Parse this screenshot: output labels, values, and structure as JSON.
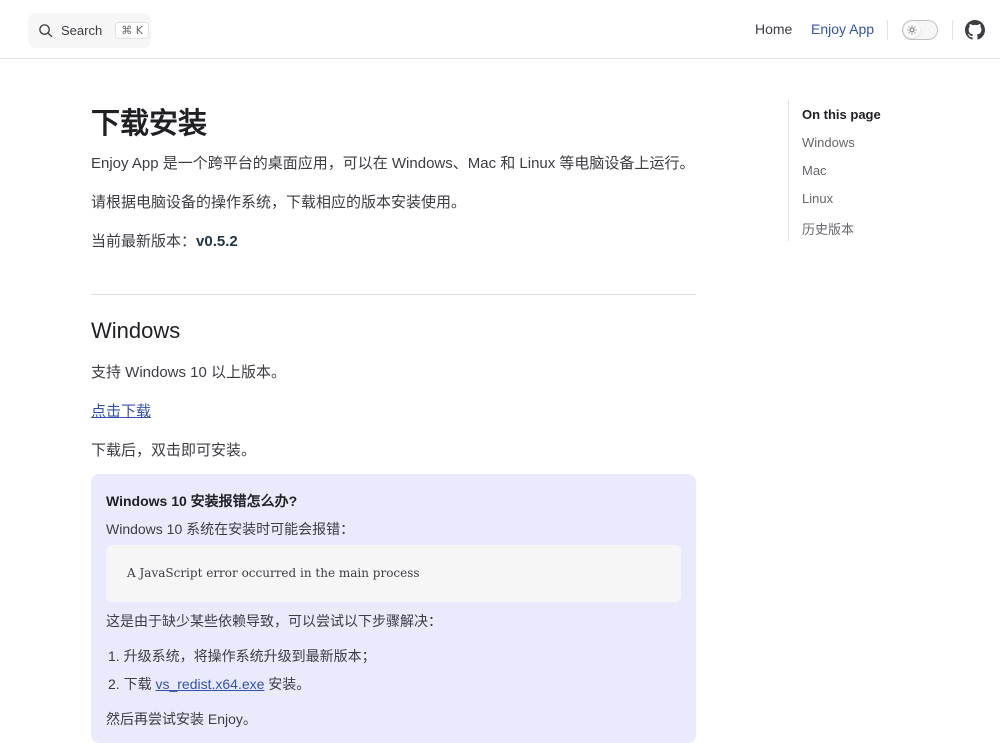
{
  "nav": {
    "search_label": "Search",
    "search_keys": "⌘ K",
    "links": [
      "Home",
      "Enjoy App"
    ],
    "accent": "#3451b2"
  },
  "main": {
    "title": "下载安装",
    "intro": "Enjoy App 是一个跨平台的桌面应用，可以在 Windows、Mac 和 Linux 等电脑设备上运行。",
    "instruction": "请根据电脑设备的操作系统，下载相应的版本安装使用。",
    "version_label": "当前最新版本：",
    "version_value": "v0.5.2",
    "windows": {
      "heading": "Windows",
      "support": "支持 Windows 10 以上版本。",
      "download_link": "点击下载",
      "after_download": "下载后，双击即可安装。",
      "tip": {
        "title": "Windows 10 安装报错怎么办?",
        "text1": "Windows 10 系统在安装时可能会报错：",
        "code": "A JavaScript error occurred in the main process",
        "text2": "这是由于缺少某些依赖导致，可以尝试以下步骤解决：",
        "step1": "1. 升级系统，将操作系统升级到最新版本；",
        "step2_prefix": "2. 下载 ",
        "step2_link": "vs_redist.x64.exe",
        "step2_suffix": " 安装。",
        "text3": "然后再尝试安装 Enjoy。",
        "background": "#e9ebfd"
      }
    }
  },
  "toc": {
    "title": "On this page",
    "items": [
      "Windows",
      "Mac",
      "Linux",
      "历史版本"
    ]
  }
}
